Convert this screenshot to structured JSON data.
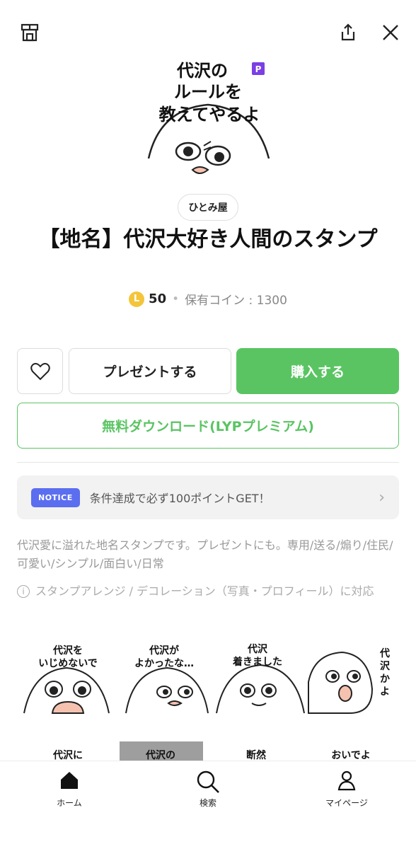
{
  "header": {
    "icons": [
      "shop-icon",
      "share-icon",
      "close-icon"
    ]
  },
  "hero": {
    "headline_lines": [
      "代沢の",
      "ルールを",
      "教えてやるよ"
    ],
    "badge": "P"
  },
  "author": "ひとみ屋",
  "title": "【地名】代沢大好き人間のスタンプ",
  "price": {
    "coin_symbol": "L",
    "amount": "50",
    "owned_coins": "保有コイン : 1300"
  },
  "actions": {
    "present_label": "プレゼントする",
    "buy_label": "購入する",
    "free_download_label": "無料ダウンロード(LYPプレミアム)"
  },
  "notice": {
    "badge": "NOTICE",
    "text": "条件達成で必ず100ポイントGET！"
  },
  "description": "代沢愛に溢れた地名スタンプです。プレゼントにも。専用/送る/煽り/住民/可愛い/シンプル/面白い/日常",
  "info": {
    "icon": "i",
    "text": "スタンプアレンジ / デコレーション（写真・プロフィール）に対応"
  },
  "stickers": [
    {
      "lines": [
        "代沢を",
        "いじめないで"
      ]
    },
    {
      "lines": [
        "代沢が",
        "よかったな…"
      ]
    },
    {
      "lines": [
        "代沢",
        "着きました"
      ]
    },
    {
      "lines": [
        "代",
        "沢",
        "か",
        "よ"
      ]
    },
    {
      "lines": [
        "代沢に"
      ]
    },
    {
      "lines": [
        "代沢の"
      ]
    },
    {
      "lines": [
        "断然"
      ]
    },
    {
      "lines": [
        "おいでよ"
      ]
    }
  ],
  "tabs": [
    {
      "label": "ホーム"
    },
    {
      "label": "検索"
    },
    {
      "label": "マイページ"
    }
  ],
  "colors": {
    "green": "#5ac463",
    "notice_blue": "#5b6ef0",
    "coin_yellow": "#f4c53a",
    "badge_purple": "#7b3fe4"
  }
}
